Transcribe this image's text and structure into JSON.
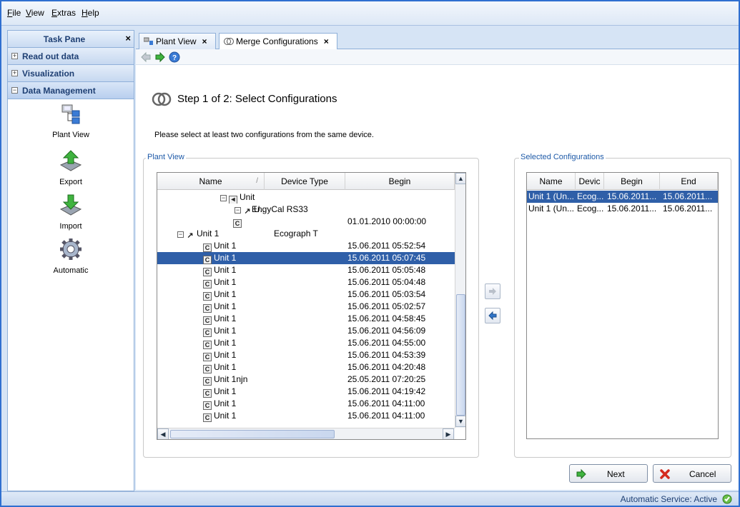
{
  "menu": [
    "File",
    "View",
    "Extras",
    "Help"
  ],
  "task_pane": {
    "title": "Task Pane",
    "close": "×",
    "sections": [
      {
        "label": "Read out data",
        "state": "+"
      },
      {
        "label": "Visualization",
        "state": "+"
      },
      {
        "label": "Data Management",
        "state": "−"
      }
    ],
    "items": [
      "Plant View",
      "Export",
      "Import",
      "Automatic"
    ]
  },
  "tabs": [
    {
      "label": "Plant View",
      "close": "×"
    },
    {
      "label": "Merge Configurations",
      "close": "×"
    }
  ],
  "step_title": "Step 1 of 2: Select Configurations",
  "instruction": "Please select at least two configurations from the same device.",
  "plant_view": {
    "legend": "Plant View",
    "columns": [
      "Name",
      "Device Type",
      "Begin"
    ],
    "sort_glyph": "/",
    "rows": [
      {
        "name": "Unit",
        "type": "",
        "begin": "",
        "icon": "unit",
        "expander": "−"
      },
      {
        "name": "U...",
        "type": "EngyCal RS33",
        "begin": "",
        "icon": "device",
        "expander": "−"
      },
      {
        "name": "",
        "type": "",
        "begin": "01.01.2010 00:00:00",
        "icon": "C",
        "expander": ""
      },
      {
        "name": "Unit 1",
        "type": "Ecograph T",
        "begin": "",
        "icon": "device",
        "expander": "−"
      },
      {
        "name": "Unit 1",
        "type": "",
        "begin": "15.06.2011 05:52:54",
        "icon": "C",
        "expander": ""
      },
      {
        "name": "Unit 1",
        "type": "",
        "begin": "15.06.2011 05:07:45",
        "icon": "C",
        "expander": "",
        "selected": true
      },
      {
        "name": "Unit 1",
        "type": "",
        "begin": "15.06.2011 05:05:48",
        "icon": "C",
        "expander": ""
      },
      {
        "name": "Unit 1",
        "type": "",
        "begin": "15.06.2011 05:04:48",
        "icon": "C",
        "expander": ""
      },
      {
        "name": "Unit 1",
        "type": "",
        "begin": "15.06.2011 05:03:54",
        "icon": "C",
        "expander": ""
      },
      {
        "name": "Unit 1",
        "type": "",
        "begin": "15.06.2011 05:02:57",
        "icon": "C",
        "expander": ""
      },
      {
        "name": "Unit 1",
        "type": "",
        "begin": "15.06.2011 04:58:45",
        "icon": "C",
        "expander": ""
      },
      {
        "name": "Unit 1",
        "type": "",
        "begin": "15.06.2011 04:56:09",
        "icon": "C",
        "expander": ""
      },
      {
        "name": "Unit 1",
        "type": "",
        "begin": "15.06.2011 04:55:00",
        "icon": "C",
        "expander": ""
      },
      {
        "name": "Unit 1",
        "type": "",
        "begin": "15.06.2011 04:53:39",
        "icon": "C",
        "expander": ""
      },
      {
        "name": "Unit 1",
        "type": "",
        "begin": "15.06.2011 04:20:48",
        "icon": "C",
        "expander": ""
      },
      {
        "name": "Unit 1njn",
        "type": "",
        "begin": "25.05.2011 07:20:25",
        "icon": "C",
        "expander": ""
      },
      {
        "name": "Unit 1",
        "type": "",
        "begin": "15.06.2011 04:19:42",
        "icon": "C",
        "expander": ""
      },
      {
        "name": "Unit 1",
        "type": "",
        "begin": "15.06.2011 04:11:00",
        "icon": "C",
        "expander": ""
      },
      {
        "name": "Unit 1",
        "type": "",
        "begin": "15.06.2011 04:11:00",
        "icon": "C",
        "expander": ""
      }
    ]
  },
  "selected_configs": {
    "legend": "Selected Configurations",
    "columns": [
      "Name",
      "Devic",
      "Begin",
      "End"
    ],
    "rows": [
      {
        "name": "Unit 1 (Un...",
        "device": "Ecog...",
        "begin": "15.06.2011...",
        "end": "15.06.2011...",
        "selected": true
      },
      {
        "name": "Unit 1 (Un...",
        "device": "Ecog...",
        "begin": "15.06.2011...",
        "end": "15.06.2011..."
      }
    ]
  },
  "buttons": {
    "next": "Next",
    "cancel": "Cancel"
  },
  "status": "Automatic Service: Active"
}
